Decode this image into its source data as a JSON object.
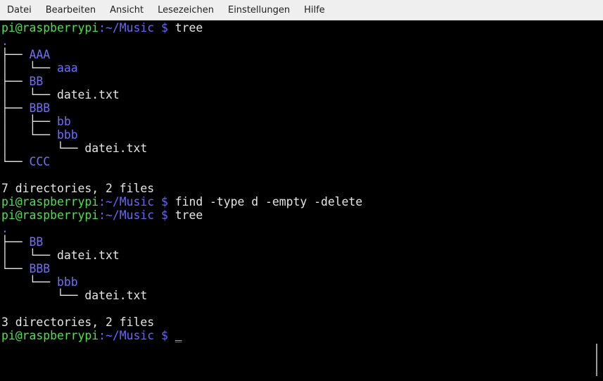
{
  "menubar": {
    "items": [
      "Datei",
      "Bearbeiten",
      "Ansicht",
      "Lesezeichen",
      "Einstellungen",
      "Hilfe"
    ]
  },
  "prompt": {
    "user_host": "pi@raspberrypi",
    "path": ":~/Music $ "
  },
  "commands": {
    "c1": "tree",
    "c2": "find -type d -empty -delete",
    "c3": "tree"
  },
  "tree1": {
    "dot": ".",
    "l1_prefix": "├── ",
    "l1_name": "AAA",
    "l2_prefix": "│   └── ",
    "l2_name": "aaa",
    "l3_prefix": "├── ",
    "l3_name": "BB",
    "l4_prefix": "│   └── ",
    "l4_name": "datei.txt",
    "l5_prefix": "├── ",
    "l5_name": "BBB",
    "l6_prefix": "│   ├── ",
    "l6_name": "bb",
    "l7_prefix": "│   └── ",
    "l7_name": "bbb",
    "l8_prefix": "│       └── ",
    "l8_name": "datei.txt",
    "l9_prefix": "└── ",
    "l9_name": "CCC",
    "summary": "7 directories, 2 files"
  },
  "tree2": {
    "dot": ".",
    "l1_prefix": "├── ",
    "l1_name": "BB",
    "l2_prefix": "│   └── ",
    "l2_name": "datei.txt",
    "l3_prefix": "└── ",
    "l3_name": "BBB",
    "l4_prefix": "    └── ",
    "l4_name": "bbb",
    "l5_prefix": "        └── ",
    "l5_name": "datei.txt",
    "summary": "3 directories, 2 files"
  },
  "cursor": "_",
  "colors": {
    "prompt_user": "#4be24b",
    "prompt_path": "#6767ff",
    "directory": "#6f6fff",
    "text": "#e5e5e5",
    "background": "#000000"
  }
}
